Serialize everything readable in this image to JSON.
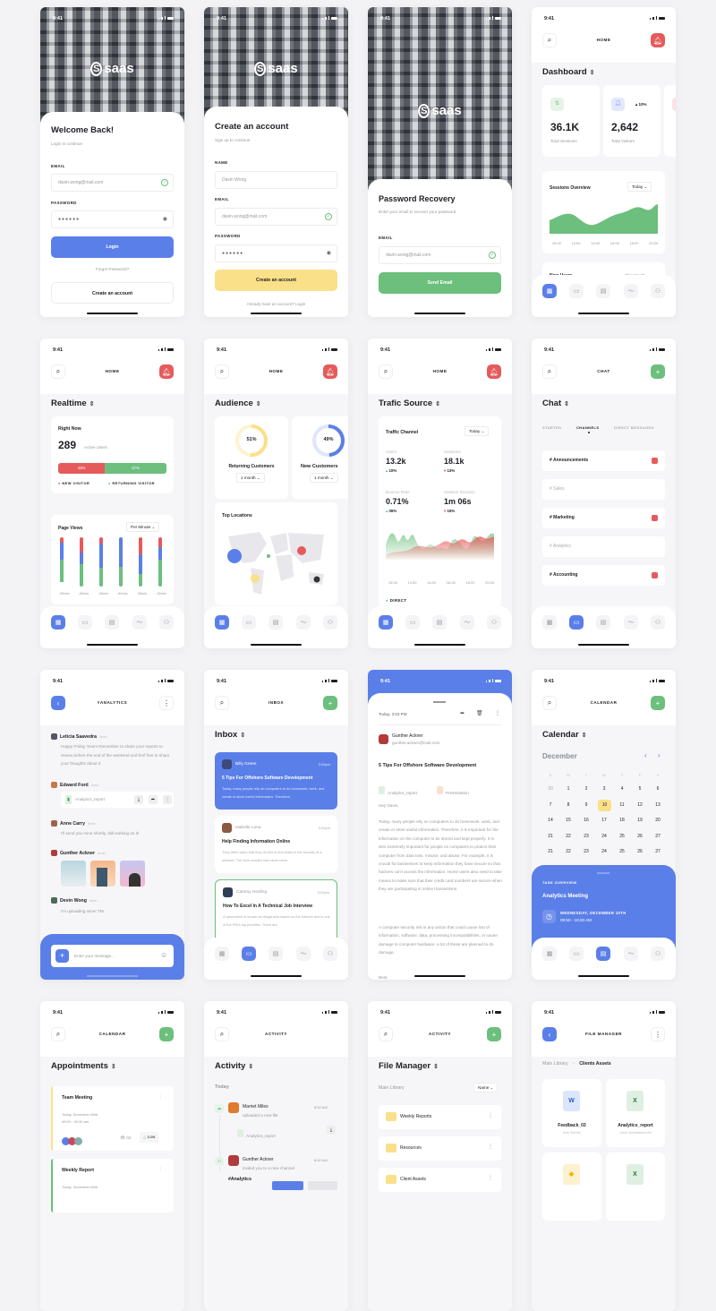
{
  "status_time": "9:41",
  "colors": {
    "primary": "#5b7fe8",
    "success": "#6cbf7c",
    "danger": "#e55b5b",
    "warning": "#fbe08a"
  },
  "brand": "saas",
  "login": {
    "title": "Welcome Back!",
    "subtitle": "Login to continue",
    "email_label": "EMAIL",
    "email_value": "davin.wong@mail.com",
    "password_label": "PASSWORD",
    "password_value": "●●●●●●",
    "login_button": "Login",
    "forgot": "Forgot Password?",
    "create_button": "Create an account"
  },
  "signup": {
    "title": "Create an account",
    "subtitle": "Sign up to continue",
    "name_label": "NAME",
    "name_value": "Davin Wong",
    "email_label": "EMAIL",
    "email_value": "davin.wong@mail.com",
    "password_label": "PASSWORD",
    "password_value": "●●●●●●",
    "create_button": "Create an account",
    "login_link": "Already have an account? Login"
  },
  "recovery": {
    "title": "Password Recovery",
    "subtitle": "Enter your email to recover your password",
    "email_label": "EMAIL",
    "email_value": "davin.wong@mail.com",
    "send_button": "Send Email"
  },
  "header_home": "HOME",
  "dashboard": {
    "title": "Dashboard",
    "stats": [
      {
        "value": "36.1K",
        "label": "Total Sessions"
      },
      {
        "value": "2,642",
        "label": "Total Visitors",
        "change": "10%"
      }
    ],
    "sessions_title": "Sessions Overview",
    "sessions_filter": "Today",
    "x_labels": [
      "10:00",
      "12:00",
      "14:00",
      "16:00",
      "18:00",
      "20:00"
    ],
    "new_users_title": "New Users",
    "new_users_filter": "This Month"
  },
  "realtime": {
    "title": "Realtime",
    "right_now": "Right Now",
    "active_count": "289",
    "active_label": "Active Users",
    "new_pct": 43,
    "returning_pct": 57,
    "new_pct_label": "43%",
    "returning_pct_label": "57%",
    "legend_new": "NEW VISITOR",
    "legend_returning": "RETURNING VISITOR",
    "page_views": "Page Views",
    "page_views_filter": "Per Minute",
    "bar_labels": [
      "-55min",
      "-50min",
      "-45min",
      "-40min",
      "-35min",
      "-30min"
    ]
  },
  "audience": {
    "title": "Audience",
    "returning_pct": 51,
    "returning_pct_label": "51%",
    "returning_label": "Returning Customers",
    "new_pct": 49,
    "new_pct_label": "49%",
    "new_label": "New Customers",
    "period": "1 month",
    "locations_title": "Top Locations"
  },
  "traffic": {
    "title": "Trafic Source",
    "card_title": "Traffic Channel",
    "filter": "Today",
    "metrics": [
      {
        "label": "Users",
        "value": "13.2k",
        "change": "10%",
        "dir": "up"
      },
      {
        "label": "Sessions",
        "value": "18.1k",
        "change": "13%",
        "dir": "down"
      },
      {
        "label": "Bounce Rate",
        "value": "0.71%",
        "change": "06%",
        "dir": "up"
      },
      {
        "label": "Session Duration",
        "value": "1m 06s",
        "change": "15%",
        "dir": "down"
      }
    ],
    "x_labels": [
      "10:00",
      "12:00",
      "14:00",
      "16:00",
      "18:00",
      "20:00"
    ],
    "legend": "DIRECT"
  },
  "chat": {
    "header": "CHAT",
    "title": "Chat",
    "tabs": [
      "STARTED",
      "CHANNELS",
      "DIRECT MESSAGES"
    ],
    "active_tab": "CHANNELS",
    "channels": [
      {
        "name": "# Announcements",
        "unread": true
      },
      {
        "name": "# Sales",
        "unread": false
      },
      {
        "name": "# Marketing",
        "unread": true
      },
      {
        "name": "# Analytics",
        "unread": false
      },
      {
        "name": "# Accounting",
        "unread": true
      }
    ]
  },
  "channel": {
    "header": "#ANALYTICS",
    "messages": [
      {
        "name": "Leticia Saavedra",
        "time": "4min",
        "text": "Happy Friday Team! Remember to share your reports to review before the end of the weekend and feel free to share your thoughts about it"
      },
      {
        "name": "Edward Ford",
        "time": "4min",
        "attachment": "Analytics_report"
      },
      {
        "name": "Anne Carry",
        "time": "4min",
        "text": "I'll send you mine shortly, still working on it!"
      },
      {
        "name": "Gunther Ackner",
        "time": "4min"
      },
      {
        "name": "Devin Wong",
        "time": "4min",
        "text": "I'm uploading mine! Tks"
      }
    ],
    "input_placeholder": "Enter your message..."
  },
  "inbox": {
    "header": "INBOX",
    "title": "Inbox",
    "mails": [
      {
        "from": "Billy Green",
        "time": "3:03pm",
        "subject": "5 Tips For Offshore Software Development",
        "preview": "Today, many people rely on computers to do homework, work, and create or store useful information. Therefore,"
      },
      {
        "from": "Isabelle Luna",
        "time": "3:03pm",
        "subject": "Help Finding Information Online",
        "preview": "They often claim that they do this to find leaks in the security of a network. The term cracker has never been"
      },
      {
        "from": "Cammy Hedling",
        "time": "3:03pm",
        "subject": "How To Excel In A Technical Job Interview",
        "preview": "A cybercrime is known as illegal acts based on the internet and is one of the FBI's top priorities. There are"
      }
    ]
  },
  "email": {
    "date": "Today, 3:03 PM",
    "sender": "Gunther Ackner",
    "sender_email": "gunther.ackner@mail.com",
    "subject": "5 Tips For Offshore Software Development",
    "attachments": [
      "Analytics_report",
      "Presentation"
    ],
    "greeting": "Hey Davin,",
    "para1": "Today, many people rely on computers to do homework, work, and create or store useful information. Therefore, it is important for the information on the computer to be stored and kept properly. It is also extremely important for people on computers to protect their computer from data loss, misuse, and abuse. For example, it is crucial for businesses to keep information they have secure so that hackers can't access the information. Home users also need to take means to make sure that their credit card numbers are secure when they are participating in online transactions.",
    "para2": "A computer security risk is any action that could cause lost of information, software, data, processing incompatibilities, or cause damage to computer hardware, a lot of these are planned to do damage.",
    "signoff": "Best,"
  },
  "calendar": {
    "header": "CALENDAR",
    "title": "Calendar",
    "month": "December",
    "weekdays": [
      "S",
      "M",
      "T",
      "W",
      "T",
      "F",
      "S"
    ],
    "weeks": [
      [
        "30",
        "1",
        "2",
        "3",
        "4",
        "5",
        "6"
      ],
      [
        "7",
        "8",
        "9",
        "10",
        "11",
        "12",
        "13"
      ],
      [
        "14",
        "15",
        "16",
        "17",
        "18",
        "19",
        "20"
      ],
      [
        "21",
        "22",
        "23",
        "24",
        "25",
        "26",
        "27"
      ],
      [
        "21",
        "22",
        "23",
        "24",
        "25",
        "26",
        "27"
      ]
    ],
    "selected": "10",
    "task_label": "TASK OVERVIEW",
    "task_title": "Analytics Meeting",
    "task_date": "WEDNESDAY, DECEMBER 10TH",
    "task_time": "09:50 - 10:20 AM"
  },
  "appointments": {
    "header": "CALENDAR",
    "title": "Appointments",
    "items": [
      {
        "title": "Team Meeting",
        "date": "Today, December 08th",
        "time": "09:00 - 09:30 am",
        "views": "03",
        "priority": "Low"
      },
      {
        "title": "Weekly Report",
        "date": "Today, December 08th"
      }
    ]
  },
  "activity": {
    "header": "ACTIVITY",
    "title": "Activity",
    "section": "Today",
    "items": [
      {
        "name": "Marriet Miles",
        "time": "8:52 AM",
        "action": "uploaded a new file",
        "attachment": "Analytics_report"
      },
      {
        "name": "Gunther Ackner",
        "time": "8:52 AM",
        "action": "invited you to a new channel",
        "channel": "#Analytics"
      }
    ]
  },
  "files": {
    "header": "ACTIVITY",
    "title": "File Manager",
    "library": "Main Library",
    "sort": "Name",
    "folders": [
      "Weekly Reports",
      "Resources",
      "Client Assets"
    ]
  },
  "file_manager": {
    "header": "FILE MANAGER",
    "breadcrumb": [
      "Main Library",
      "Clients Assets"
    ],
    "files": [
      {
        "name": "Feedback_03",
        "meta": "6mb Text file",
        "type": "word"
      },
      {
        "name": "Analytics_report",
        "meta": "12mb Spreadsheet file",
        "type": "excel"
      },
      {
        "type": "sketch"
      },
      {
        "type": "excel"
      }
    ]
  }
}
